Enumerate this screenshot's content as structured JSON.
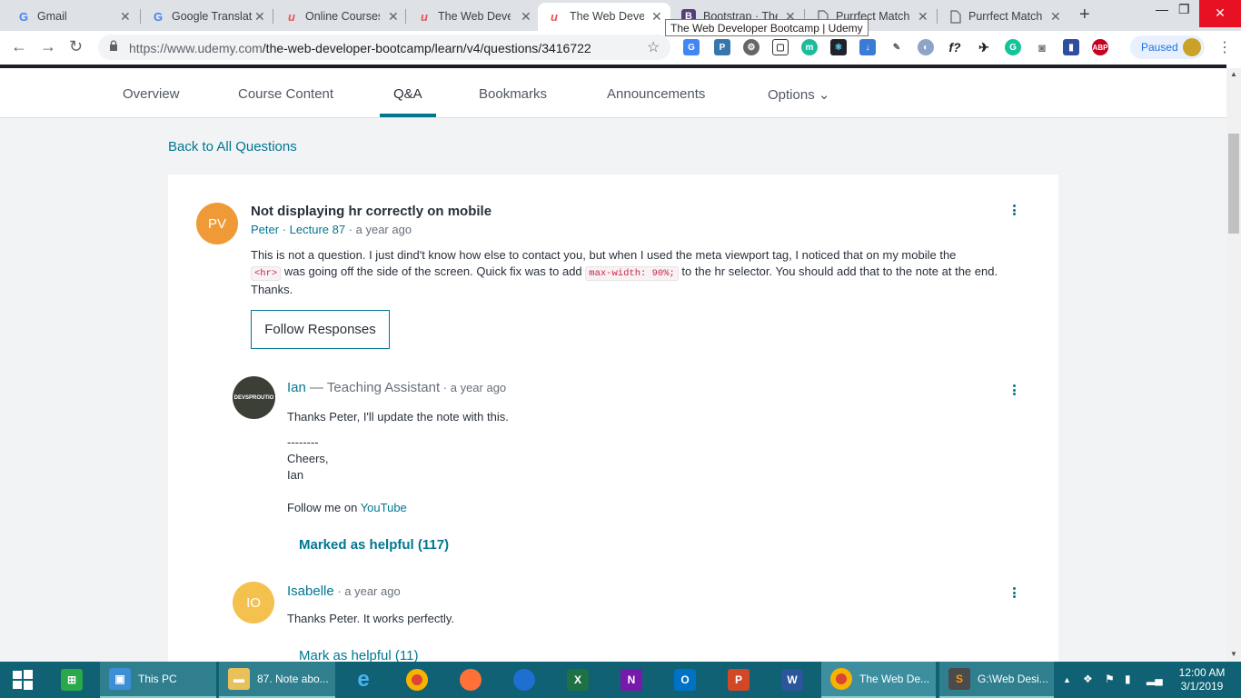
{
  "browser": {
    "tabs": [
      {
        "title": "Gmail",
        "favicon": "G",
        "favicon_color": "#4285f4"
      },
      {
        "title": "Google Translat",
        "favicon": "G",
        "favicon_color": "#4285f4"
      },
      {
        "title": "Online Courses",
        "favicon": "u",
        "favicon_color": "#ec5252"
      },
      {
        "title": "The Web Devel",
        "favicon": "u",
        "favicon_color": "#ec5252"
      },
      {
        "title": "The Web Devel",
        "favicon": "u",
        "favicon_color": "#ec5252",
        "active": true
      },
      {
        "title": "Bootstrap · The",
        "favicon": "B",
        "favicon_color": "#563d7c"
      },
      {
        "title": "Purrfect Match",
        "favicon": "doc",
        "favicon_color": "#5f6368"
      },
      {
        "title": "Purrfect Match",
        "favicon": "doc",
        "favicon_color": "#5f6368"
      }
    ],
    "tooltip": "The Web Developer Bootcamp | Udemy",
    "url_host": "https://www.udemy.com",
    "url_path": "/the-web-developer-bootcamp/learn/v4/questions/3416722",
    "profile_status": "Paused"
  },
  "nav": {
    "tabs": [
      "Overview",
      "Course Content",
      "Q&A",
      "Bookmarks",
      "Announcements",
      "Options ⌄"
    ],
    "active_tab": "Q&A"
  },
  "back_link": "Back to All Questions",
  "question": {
    "avatar_initials": "PV",
    "avatar_color": "#f09a37",
    "title": "Not displaying hr correctly on mobile",
    "author": "Peter",
    "sep1": " · ",
    "lecture": "Lecture 87",
    "time": " · a year ago",
    "body_1": "This is not a question. I just dind't know how else to contact you, but when I used the meta viewport tag, I noticed that on my mobile the",
    "code_1": "<hr>",
    "body_2": " was going off the side of the screen. Quick fix was to add ",
    "code_2": "max-width: 90%;",
    "body_3": " to the hr selector. You should add that to the note at the end. Thanks.",
    "follow_label": "Follow Responses"
  },
  "replies": [
    {
      "avatar_text": "DEVSPROUTIO",
      "name": "Ian",
      "role": " — Teaching Assistant",
      "time": " · a year ago",
      "line_1": "Thanks Peter, I'll update the note with this.",
      "line_2": "--------",
      "line_3": "Cheers,",
      "line_4": "Ian",
      "follow_prefix": "Follow me on ",
      "follow_link": "YouTube",
      "helpful": "Marked as helpful (117)"
    },
    {
      "avatar_initials": "IO",
      "avatar_color": "#f4c14e",
      "name": "Isabelle",
      "time": " · a year ago",
      "line_1": "Thanks Peter. It works perfectly.",
      "helpful": "Mark as helpful (11)"
    }
  ],
  "taskbar": {
    "items": [
      {
        "label": "This PC"
      },
      {
        "label": "87. Note abo..."
      },
      {
        "label": "The Web De..."
      },
      {
        "label": "G:\\Web Desi..."
      }
    ],
    "time": "12:00 AM",
    "date": "3/1/2019"
  }
}
